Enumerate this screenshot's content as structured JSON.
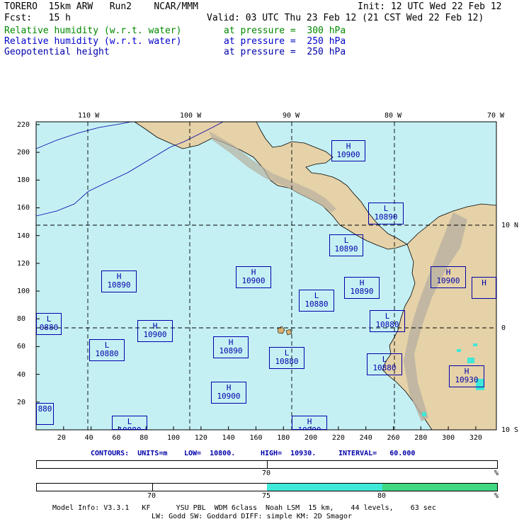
{
  "header": {
    "line1_left": "TORERO  15km ARW   Run2    NCAR/MMM",
    "line1_right": "Init: 12 UTC Wed 22 Feb 12",
    "line2_left": "Fcst:   15 h",
    "line2_right": "Valid: 03 UTC Thu 23 Feb 12 (21 CST Wed 22 Feb 12)",
    "fields": [
      {
        "name": "Relative humidity (w.r.t. water)",
        "level": "at pressure =  300 hPa",
        "color": "#008800"
      },
      {
        "name": "Relative humidity (w.r.t. water)",
        "level": "at pressure =  250 hPa",
        "color": "#0000cc"
      },
      {
        "name": "Geopotential height",
        "level": "at pressure =  250 hPa",
        "color": "#0000aa"
      }
    ]
  },
  "map": {
    "ocean_color": "#c4f0f4",
    "lon_labels": [
      "110 W",
      "100 W",
      "90 W",
      "80 W",
      "70 W"
    ],
    "lat_labels": [
      "10 N",
      "0",
      "10 S"
    ],
    "y_ticks": [
      220,
      200,
      180,
      160,
      140,
      120,
      100,
      80,
      60,
      40,
      20
    ],
    "x_ticks": [
      20,
      40,
      60,
      80,
      100,
      120,
      140,
      160,
      180,
      200,
      220,
      240,
      260,
      280,
      300,
      320
    ],
    "pressure_centers": [
      {
        "type": "H",
        "value": "10900"
      },
      {
        "type": "L",
        "value": "10890"
      },
      {
        "type": "L",
        "value": "10890"
      },
      {
        "type": "H",
        "value": "10890"
      },
      {
        "type": "H",
        "value": "10900"
      },
      {
        "type": "H",
        "value": "10900"
      },
      {
        "type": "L",
        "value": "10880"
      },
      {
        "type": "H",
        "value": "10890"
      },
      {
        "type": "L",
        "value": "0880"
      },
      {
        "type": "H",
        "value": "10900"
      },
      {
        "type": "L",
        "value": "10880"
      },
      {
        "type": "L",
        "value": "10880"
      },
      {
        "type": "H",
        "value": "10890"
      },
      {
        "type": "L",
        "value": "10880"
      },
      {
        "type": "L",
        "value": "10880"
      },
      {
        "type": "H",
        "value": "10900"
      },
      {
        "type": "H",
        "value": "10930"
      },
      {
        "type": "",
        "value": "880"
      },
      {
        "type": "L",
        "value": "10880"
      },
      {
        "type": "H",
        "value": "10900"
      },
      {
        "type": "H",
        "value": ""
      },
      {
        "type": "L",
        "value": "10880"
      }
    ]
  },
  "contours": {
    "units_label": "CONTOURS:  UNITS=m",
    "low_label": "LOW=  10800.",
    "high_label": "HIGH=  10930.",
    "interval_label": "INTERVAL=   60.000"
  },
  "scale1": {
    "tick": "70",
    "unit": "%"
  },
  "scale2": {
    "ticks": [
      "70",
      "75",
      "80"
    ],
    "unit": "%",
    "fill1": "#40e8d8",
    "fill2": "#40d880"
  },
  "footer": {
    "line1": "Model Info: V3.3.1   KF      YSU PBL  WDM 6class  Noah LSM  15 km,    44 levels,    63 sec",
    "line2": "LW: Godd SW: Goddard DIFF: simple KM: 2D Smagor"
  }
}
